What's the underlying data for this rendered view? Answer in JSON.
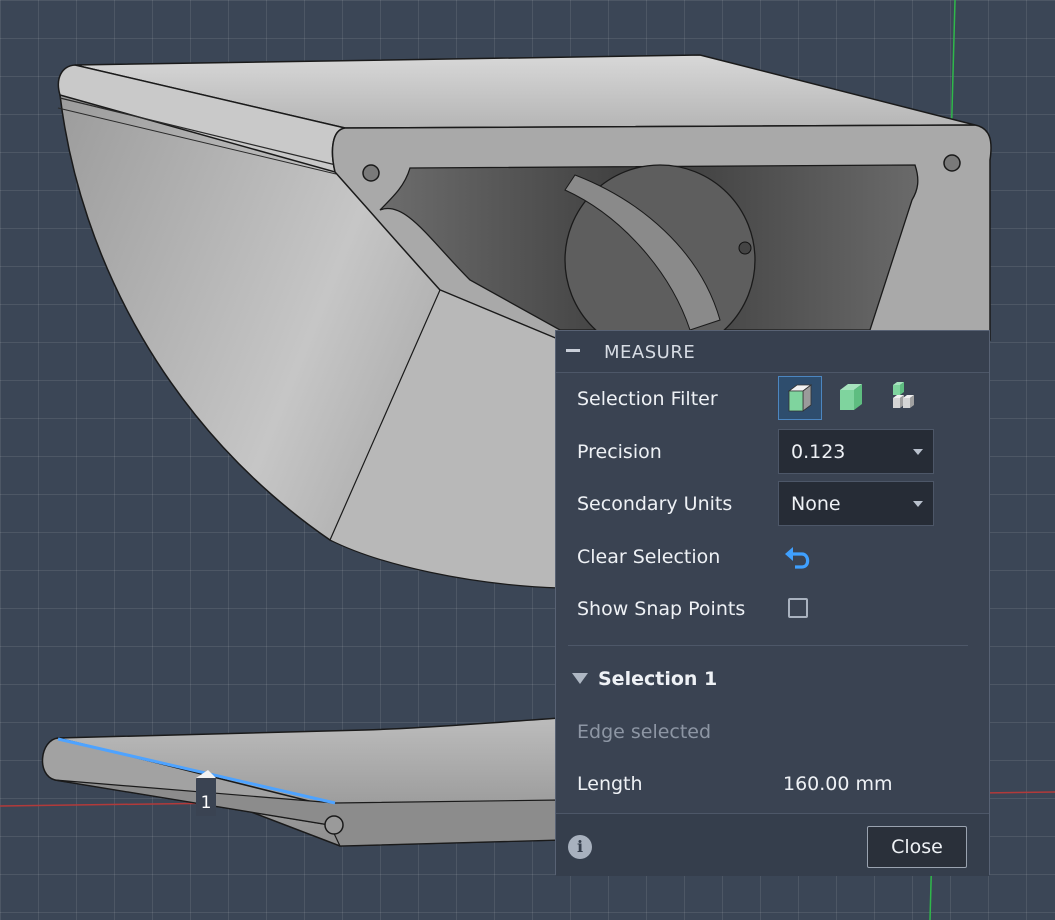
{
  "measure": {
    "title": "MEASURE",
    "selection_filter_label": "Selection Filter",
    "filter_buttons": [
      "body-filter-icon",
      "face-filter-icon",
      "edge-filter-icon"
    ],
    "precision_label": "Precision",
    "precision_value": "0.123",
    "secondary_units_label": "Secondary Units",
    "secondary_units_value": "None",
    "clear_selection_label": "Clear Selection",
    "show_snap_points_label": "Show Snap Points",
    "show_snap_points_checked": false,
    "selection_header": "Selection 1",
    "selection_status": "Edge selected",
    "length_label": "Length",
    "length_value": "160.00 mm",
    "close_label": "Close",
    "info_glyph": "i"
  },
  "viewport": {
    "selected_edge_marker": "1",
    "colors": {
      "background": "#3b4656",
      "model": "#8a8a8a",
      "selected_edge": "#4ea3ff",
      "accent": "#3fa0ff"
    }
  }
}
